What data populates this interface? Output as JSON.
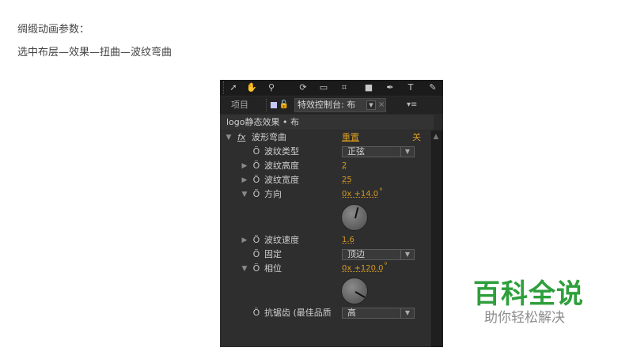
{
  "intro": {
    "line1": "绸缎动画参数：",
    "line2": "选中布层—效果—扭曲—波纹弯曲"
  },
  "toolbar": {
    "icons": [
      "selection-arrow-icon",
      "hand-icon",
      "zoom-icon",
      "rotate-icon",
      "camera-icon",
      "pan-behind-icon",
      "rectangle-icon",
      "pen-icon",
      "text-icon",
      "brush-icon"
    ]
  },
  "tabs": {
    "project": "项目",
    "effect_controls": "特效控制台: 布",
    "menu_glyph": "▾≡"
  },
  "breadcrumb": "logo静态效果 • 布",
  "effect": {
    "fx_label": "fx",
    "name": "波形弯曲",
    "reset": "重置",
    "about": "关",
    "properties": {
      "wave_type": {
        "label": "波纹类型",
        "value": "正弦"
      },
      "wave_height": {
        "label": "波纹高度",
        "value": "2"
      },
      "wave_width": {
        "label": "波纹宽度",
        "value": "25"
      },
      "direction": {
        "label": "方向",
        "value": "0x +14.0",
        "unit": "°",
        "angle": 14.0
      },
      "wave_speed": {
        "label": "波纹速度",
        "value": "1.6"
      },
      "pinning": {
        "label": "固定",
        "value": "顶边"
      },
      "phase": {
        "label": "相位",
        "value": "0x +120.0",
        "unit": "°",
        "angle": 120.0
      },
      "antialias": {
        "label": "抗锯齿 (最佳品质",
        "value": "高"
      }
    }
  },
  "colors": {
    "value_orange": "#d59a22",
    "panel_bg": "#2e2e2e",
    "brand_green": "#2e9f3c"
  },
  "watermark": {
    "title": "百科全说",
    "subtitle": "助你轻松解决"
  }
}
